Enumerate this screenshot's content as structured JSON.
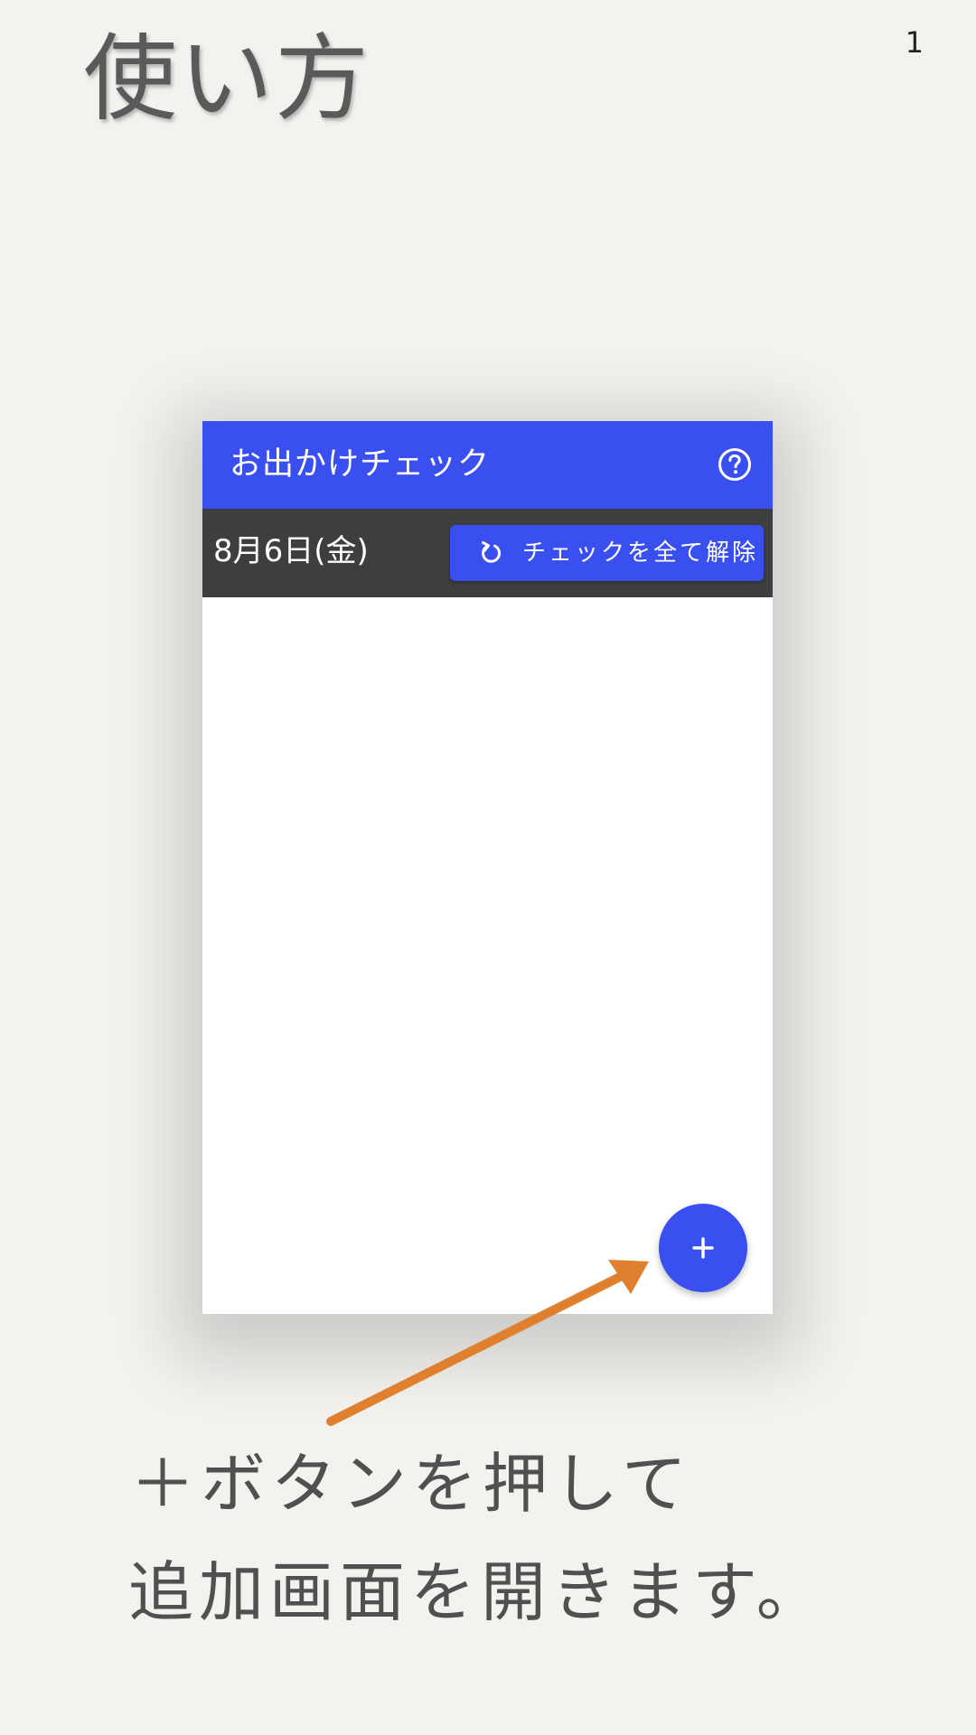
{
  "page": {
    "title": "使い方",
    "number": "1"
  },
  "app": {
    "title": "お出かけチェック",
    "help_icon": "help-circle-icon",
    "date": "8月6日(金)",
    "reset_button_label": "チェックを全て解除",
    "reset_icon": "refresh-icon",
    "fab_icon": "plus-icon",
    "accent_color": "#3a4ff0",
    "date_bar_color": "#3e3e3e"
  },
  "caption": {
    "line1": "＋ボタンを押して",
    "line2": "追加画面を開きます。"
  },
  "annotation": {
    "arrow_color": "#e07f2e"
  }
}
